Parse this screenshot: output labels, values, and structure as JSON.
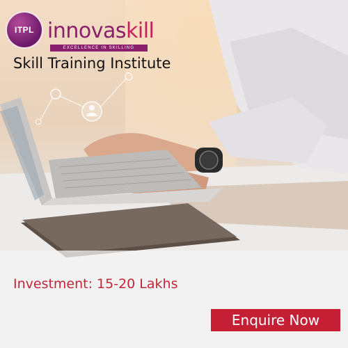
{
  "logo": {
    "emblem_text": "ITPL",
    "brand_part1": "innovas",
    "brand_part2": "kill",
    "tagline": "EXCELLENCE IN SKILLING"
  },
  "headline": "Skill Training Institute",
  "investment": "Investment: 15-20 Lakhs",
  "cta_label": "Enquire Now",
  "colors": {
    "brand_purple": "#8a1f6c",
    "accent_red": "#c51f35",
    "text_red": "#c3253a"
  }
}
